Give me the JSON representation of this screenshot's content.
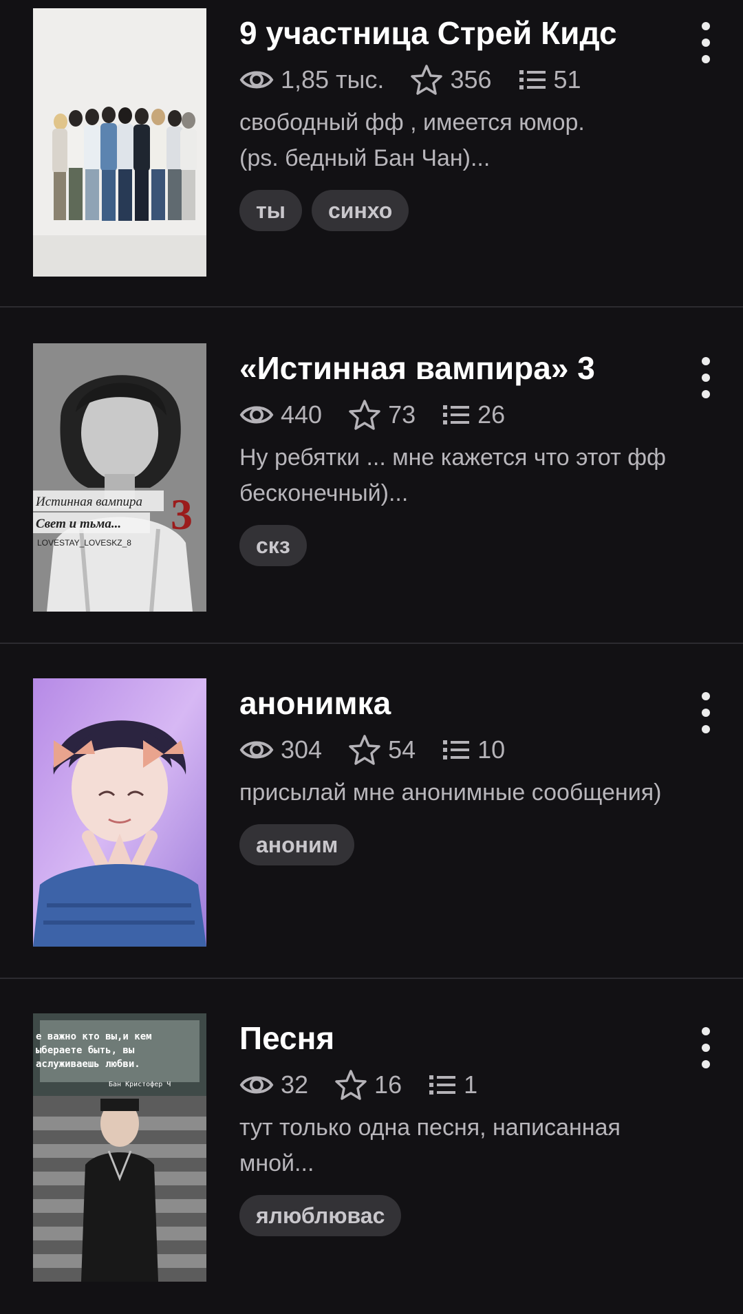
{
  "stories": [
    {
      "title": "9 участница Стрей Кидс",
      "views": "1,85 тыс.",
      "stars": "356",
      "chapters": "51",
      "description": [
        "свободный фф , имеется юмор.",
        "(ps. бедный Бан Чан)..."
      ],
      "tags": [
        "ты",
        "синхо"
      ]
    },
    {
      "title": "«Истинная вампира» 3",
      "views": "440",
      "stars": "73",
      "chapters": "26",
      "description": [
        "Ну ребятки ... мне кажется что этот фф",
        "бесконечный)..."
      ],
      "tags": [
        "скз"
      ],
      "cover_text": {
        "line1": "Истинная вампира",
        "line2": "Свет и тьма...",
        "number": "3",
        "author": "LOVESTAY_LOVESKZ_8"
      }
    },
    {
      "title": "анонимка",
      "views": "304",
      "stars": "54",
      "chapters": "10",
      "description": [
        "присылай мне анонимные сообщения)"
      ],
      "tags": [
        "аноним"
      ]
    },
    {
      "title": "Песня",
      "views": "32",
      "stars": "16",
      "chapters": "1",
      "description": [
        "тут только одна песня, написанная",
        "мной..."
      ],
      "tags": [
        "ялюблювас"
      ],
      "cover_text": {
        "line1": "е важно кто вы,и кем",
        "line2": "ыбераете быть, вы",
        "line3": "аслуживаешь любви.",
        "signature": "Бан Кристофер Ч"
      }
    }
  ],
  "colors": {
    "background": "#121114",
    "divider": "#2c2b30",
    "tag_background": "#333236",
    "meta_text": "#b5b3b8"
  },
  "icons": {
    "views": "eye-icon",
    "stars": "star-icon",
    "chapters": "list-icon",
    "menu": "more-vertical-icon"
  }
}
